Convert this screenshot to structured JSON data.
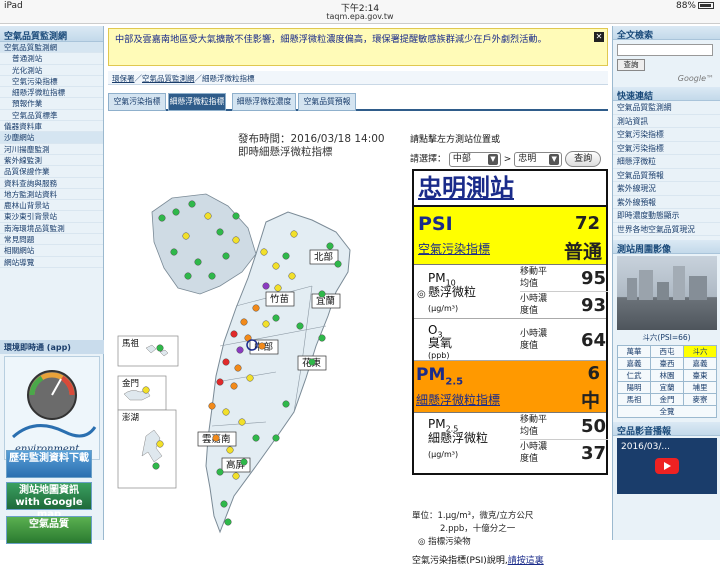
{
  "status_bar": {
    "device": "iPad",
    "time": "下午2:14",
    "battery": "88%"
  },
  "url": "taqm.epa.gov.tw",
  "left_nav": {
    "title": "空氣品質監測網",
    "items": [
      {
        "label": "空氣品質監測網",
        "type": "grp"
      },
      {
        "label": "普通測站",
        "type": "sub"
      },
      {
        "label": "光化測站",
        "type": "sub"
      },
      {
        "label": "空氣污染指標",
        "type": "sub"
      },
      {
        "label": "細懸浮微粒指標",
        "type": "sub"
      },
      {
        "label": "預報作業",
        "type": "sub"
      },
      {
        "label": "空氣品質標準",
        "type": "sub"
      },
      {
        "label": "儀器資料庫",
        "type": ""
      },
      {
        "label": "沙塵網站",
        "type": "grp"
      },
      {
        "label": "河川揚塵監測",
        "type": ""
      },
      {
        "label": "紫外線監測",
        "type": ""
      },
      {
        "label": "品質保證作業",
        "type": ""
      },
      {
        "label": "資料查詢與服務",
        "type": ""
      },
      {
        "label": "地方監測站資料",
        "type": ""
      },
      {
        "label": "鹿林山背景站",
        "type": ""
      },
      {
        "label": "東沙東引背景站",
        "type": ""
      },
      {
        "label": "南海環境品質監測",
        "type": ""
      },
      {
        "label": "常見問題",
        "type": ""
      },
      {
        "label": "相關網站",
        "type": ""
      },
      {
        "label": "網站導覽",
        "type": ""
      }
    ],
    "realtime": "環境即時通 (app)",
    "gauge_logo": "environment",
    "banner1": "歷年監測資料下載",
    "banner2": "測站地圖資訊 with Google map",
    "banner3": "空氣品質"
  },
  "alert": {
    "text": "中部及雲嘉南地區受大氣擴散不佳影響，細懸浮微粒濃度偏高，環保署提醒敏感族群減少在戶外劇烈活動。",
    "close": "✕"
  },
  "breadcrumb": {
    "home": "環保署",
    "sep": "／",
    "section": "空氣品質監測網",
    "current": "細懸浮微粒指標"
  },
  "tabs": [
    "空氣污染指標",
    "細懸浮微粒指標",
    "細懸浮微粒濃度",
    "空氣品質預報"
  ],
  "active_tab": 1,
  "publish": {
    "line1": "發布時間：2016/03/18 14:00",
    "line2": "即時細懸浮微粒指標"
  },
  "map": {
    "regions": [
      "北部",
      "竹苗",
      "宜蘭",
      "中部",
      "花東",
      "雲嘉南",
      "高屏"
    ],
    "islands": [
      "馬祖",
      "金門",
      "澎湖"
    ]
  },
  "panel": {
    "prompt": "請點擊左方測站位置或",
    "select_label": "請選擇：",
    "region": "中部",
    "station_sel": "忠明",
    "gt": ">",
    "query": "查詢",
    "station_name": "忠明測站",
    "psi": {
      "label": "PSI",
      "sub": "空氣污染指標",
      "value": "72",
      "status": "普通"
    },
    "pm10": {
      "name": "PM",
      "subscript": "10",
      "cn": "懸浮微粒",
      "unit": "(μg/m³)",
      "avg_label": "移動平均值",
      "avg": "95",
      "hr_label": "小時濃度值",
      "hr": "93"
    },
    "o3": {
      "name": "O",
      "subscript": "3",
      "cn": "臭氧",
      "unit": "(ppb)",
      "hr_label": "小時濃度值",
      "hr": "64"
    },
    "pm25": {
      "label": "PM",
      "subscript": "2.5",
      "sub": "細懸浮微粒指標",
      "value": "6",
      "status": "中"
    },
    "pm25c": {
      "name": "PM",
      "subscript": "2.5",
      "cn": "細懸浮微粒",
      "unit": "(μg/m³)",
      "avg_label": "移動平均值",
      "avg": "50",
      "hr_label": "小時濃度值",
      "hr": "37"
    },
    "units1": "單位：1.μg/m³，微克/立方公尺",
    "units2": "2.ppb，十億分之一",
    "units3": "指標污染物",
    "psi_desc": "空氣污染指標(PSI)說明,",
    "psi_link": "請按這裏"
  },
  "right_nav": {
    "search_title": "全文檢索",
    "search_btn": "查詢",
    "google": "Google™",
    "quick_title": "快速連結",
    "quick": [
      "空氣品質監測網",
      "測站資訊",
      "空氣污染指標",
      "空氣污染指標",
      "細懸浮微粒",
      "空氣品質預報",
      "紫外線現況",
      "紫外線預報",
      "即時濃度動態顯示",
      "世界各地空氣品質現況"
    ],
    "photo_title": "測站周圍影像",
    "photo_caption": "斗六(PSI=66)",
    "areas": [
      [
        "萬華",
        "西屯",
        "斗六"
      ],
      [
        "嘉義",
        "臺西",
        "嘉義"
      ],
      [
        "仁武",
        "林園",
        "臺東"
      ],
      [
        "陽明",
        "宜蘭",
        "埔里"
      ],
      [
        "馬祖",
        "金門",
        "麥寮"
      ],
      [
        "全覽"
      ]
    ],
    "video_title": "空品影音播報",
    "video_text": "2016/03/..."
  }
}
